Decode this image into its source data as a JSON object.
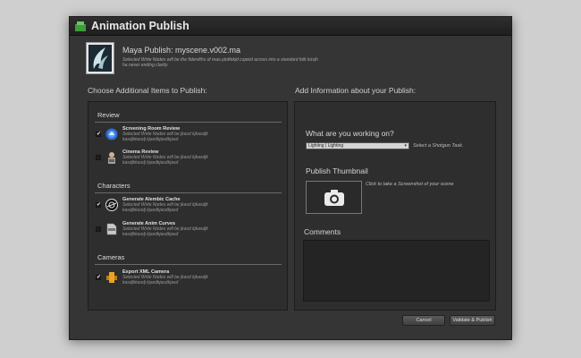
{
  "window": {
    "title": "Animation Publish"
  },
  "header": {
    "title": "Maya Publish: myscene.v002.ma",
    "subtitle": "Selected Write Nodes will be the fidenliths of mao plotfekjd copied across into a standard folk kosjh ha never ending clarity."
  },
  "left": {
    "heading": "Choose Additional Items to Publish:",
    "groups": [
      {
        "title": "Review",
        "items": [
          {
            "name": "Screening Room Review",
            "desc": "Selected Write Nodes will be jkasd kjkasdjk kasdjkkasdj kjasdkjasdkjasd",
            "checked": "✔",
            "icon": "screening-room-icon"
          },
          {
            "name": "Cinema Review",
            "desc": "Selected Write Nodes will be jkasd kjkasdjk kasdjkkasdj kjasdkjasdkjasd",
            "checked": "",
            "icon": "cinema-icon"
          }
        ]
      },
      {
        "title": "Characters",
        "items": [
          {
            "name": "Generate Alembic Cache",
            "desc": "Selected Write Nodes will be jkasd kjkasdjk kasdjkkasdj kjasdkjasdkjasd",
            "checked": "✔",
            "icon": "alembic-icon"
          },
          {
            "name": "Generate Anim Curves",
            "desc": "Selected Write Nodes will be jkasd kjkasdjk kasdjkkasdj kjasdkjasdkjasd",
            "checked": "",
            "icon": "xml-file-icon"
          }
        ]
      },
      {
        "title": "Cameras",
        "items": [
          {
            "name": "Export XML Camera",
            "desc": "Selected Write Nodes will be jkasd kjkasdjk kasdjkkasdj kjasdkjasdkjasd",
            "checked": "✔",
            "icon": "camera-icon"
          }
        ]
      }
    ]
  },
  "right": {
    "heading": "Add Information about your Publish:",
    "task_label": "What are you working on?",
    "task_value": "Lighting | Lighting",
    "task_hint": "Select a Shotgun Task.",
    "thumb_label": "Publish Thumbnail",
    "thumb_hint": "Click to take a Screenshot of your scene",
    "comments_label": "Comments"
  },
  "buttons": {
    "cancel": "Cancel",
    "validate": "Validate & Publish"
  }
}
